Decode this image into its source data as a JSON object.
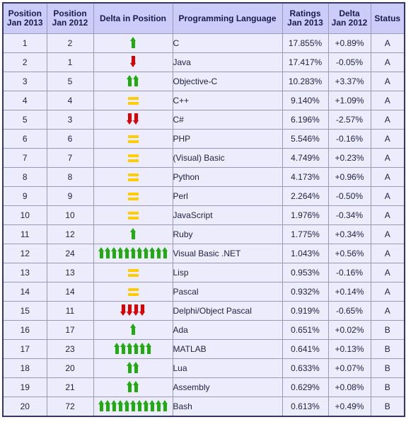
{
  "table": {
    "columns": [
      {
        "key": "pos_2013",
        "line1": "Position",
        "line2": "Jan 2013"
      },
      {
        "key": "pos_2012",
        "line1": "Position",
        "line2": "Jan 2012"
      },
      {
        "key": "delta_pos",
        "line1": "Delta in Position",
        "line2": ""
      },
      {
        "key": "language",
        "line1": "Programming Language",
        "line2": ""
      },
      {
        "key": "ratings",
        "line1": "Ratings",
        "line2": "Jan 2013"
      },
      {
        "key": "delta_r",
        "line1": "Delta",
        "line2": "Jan 2012"
      },
      {
        "key": "status",
        "line1": "Status",
        "line2": ""
      }
    ],
    "rows": [
      {
        "pos_2013": "1",
        "pos_2012": "2",
        "delta_dir": "up",
        "delta_count": 1,
        "language": "C",
        "ratings": "17.855%",
        "delta_r": "+0.89%",
        "status": "A"
      },
      {
        "pos_2013": "2",
        "pos_2012": "1",
        "delta_dir": "down",
        "delta_count": 1,
        "language": "Java",
        "ratings": "17.417%",
        "delta_r": "-0.05%",
        "status": "A"
      },
      {
        "pos_2013": "3",
        "pos_2012": "5",
        "delta_dir": "up",
        "delta_count": 2,
        "language": "Objective-C",
        "ratings": "10.283%",
        "delta_r": "+3.37%",
        "status": "A"
      },
      {
        "pos_2013": "4",
        "pos_2012": "4",
        "delta_dir": "equal",
        "delta_count": 0,
        "language": "C++",
        "ratings": "9.140%",
        "delta_r": "+1.09%",
        "status": "A"
      },
      {
        "pos_2013": "5",
        "pos_2012": "3",
        "delta_dir": "down",
        "delta_count": 2,
        "language": "C#",
        "ratings": "6.196%",
        "delta_r": "-2.57%",
        "status": "A"
      },
      {
        "pos_2013": "6",
        "pos_2012": "6",
        "delta_dir": "equal",
        "delta_count": 0,
        "language": "PHP",
        "ratings": "5.546%",
        "delta_r": "-0.16%",
        "status": "A"
      },
      {
        "pos_2013": "7",
        "pos_2012": "7",
        "delta_dir": "equal",
        "delta_count": 0,
        "language": "(Visual) Basic",
        "ratings": "4.749%",
        "delta_r": "+0.23%",
        "status": "A"
      },
      {
        "pos_2013": "8",
        "pos_2012": "8",
        "delta_dir": "equal",
        "delta_count": 0,
        "language": "Python",
        "ratings": "4.173%",
        "delta_r": "+0.96%",
        "status": "A"
      },
      {
        "pos_2013": "9",
        "pos_2012": "9",
        "delta_dir": "equal",
        "delta_count": 0,
        "language": "Perl",
        "ratings": "2.264%",
        "delta_r": "-0.50%",
        "status": "A"
      },
      {
        "pos_2013": "10",
        "pos_2012": "10",
        "delta_dir": "equal",
        "delta_count": 0,
        "language": "JavaScript",
        "ratings": "1.976%",
        "delta_r": "-0.34%",
        "status": "A"
      },
      {
        "pos_2013": "11",
        "pos_2012": "12",
        "delta_dir": "up",
        "delta_count": 1,
        "language": "Ruby",
        "ratings": "1.775%",
        "delta_r": "+0.34%",
        "status": "A"
      },
      {
        "pos_2013": "12",
        "pos_2012": "24",
        "delta_dir": "up",
        "delta_count": 11,
        "language": "Visual Basic .NET",
        "ratings": "1.043%",
        "delta_r": "+0.56%",
        "status": "A"
      },
      {
        "pos_2013": "13",
        "pos_2012": "13",
        "delta_dir": "equal",
        "delta_count": 0,
        "language": "Lisp",
        "ratings": "0.953%",
        "delta_r": "-0.16%",
        "status": "A"
      },
      {
        "pos_2013": "14",
        "pos_2012": "14",
        "delta_dir": "equal",
        "delta_count": 0,
        "language": "Pascal",
        "ratings": "0.932%",
        "delta_r": "+0.14%",
        "status": "A"
      },
      {
        "pos_2013": "15",
        "pos_2012": "11",
        "delta_dir": "down",
        "delta_count": 4,
        "language": "Delphi/Object Pascal",
        "ratings": "0.919%",
        "delta_r": "-0.65%",
        "status": "A"
      },
      {
        "pos_2013": "16",
        "pos_2012": "17",
        "delta_dir": "up",
        "delta_count": 1,
        "language": "Ada",
        "ratings": "0.651%",
        "delta_r": "+0.02%",
        "status": "B"
      },
      {
        "pos_2013": "17",
        "pos_2012": "23",
        "delta_dir": "up",
        "delta_count": 6,
        "language": "MATLAB",
        "ratings": "0.641%",
        "delta_r": "+0.13%",
        "status": "B"
      },
      {
        "pos_2013": "18",
        "pos_2012": "20",
        "delta_dir": "up",
        "delta_count": 2,
        "language": "Lua",
        "ratings": "0.633%",
        "delta_r": "+0.07%",
        "status": "B"
      },
      {
        "pos_2013": "19",
        "pos_2012": "21",
        "delta_dir": "up",
        "delta_count": 2,
        "language": "Assembly",
        "ratings": "0.629%",
        "delta_r": "+0.08%",
        "status": "B"
      },
      {
        "pos_2013": "20",
        "pos_2012": "72",
        "delta_dir": "up",
        "delta_count": 11,
        "language": "Bash",
        "ratings": "0.613%",
        "delta_r": "+0.49%",
        "status": "B"
      }
    ]
  },
  "colors": {
    "header_bg": "#ccccf9",
    "row_bg": "#ececfc",
    "border": "#9a9ab8",
    "outer_border": "#333377",
    "arrow_up": "#22aa11",
    "arrow_down": "#dd0000",
    "equals": "#ffcc00",
    "language_text": "#2222bb",
    "header_text": "#1a1a4d"
  }
}
